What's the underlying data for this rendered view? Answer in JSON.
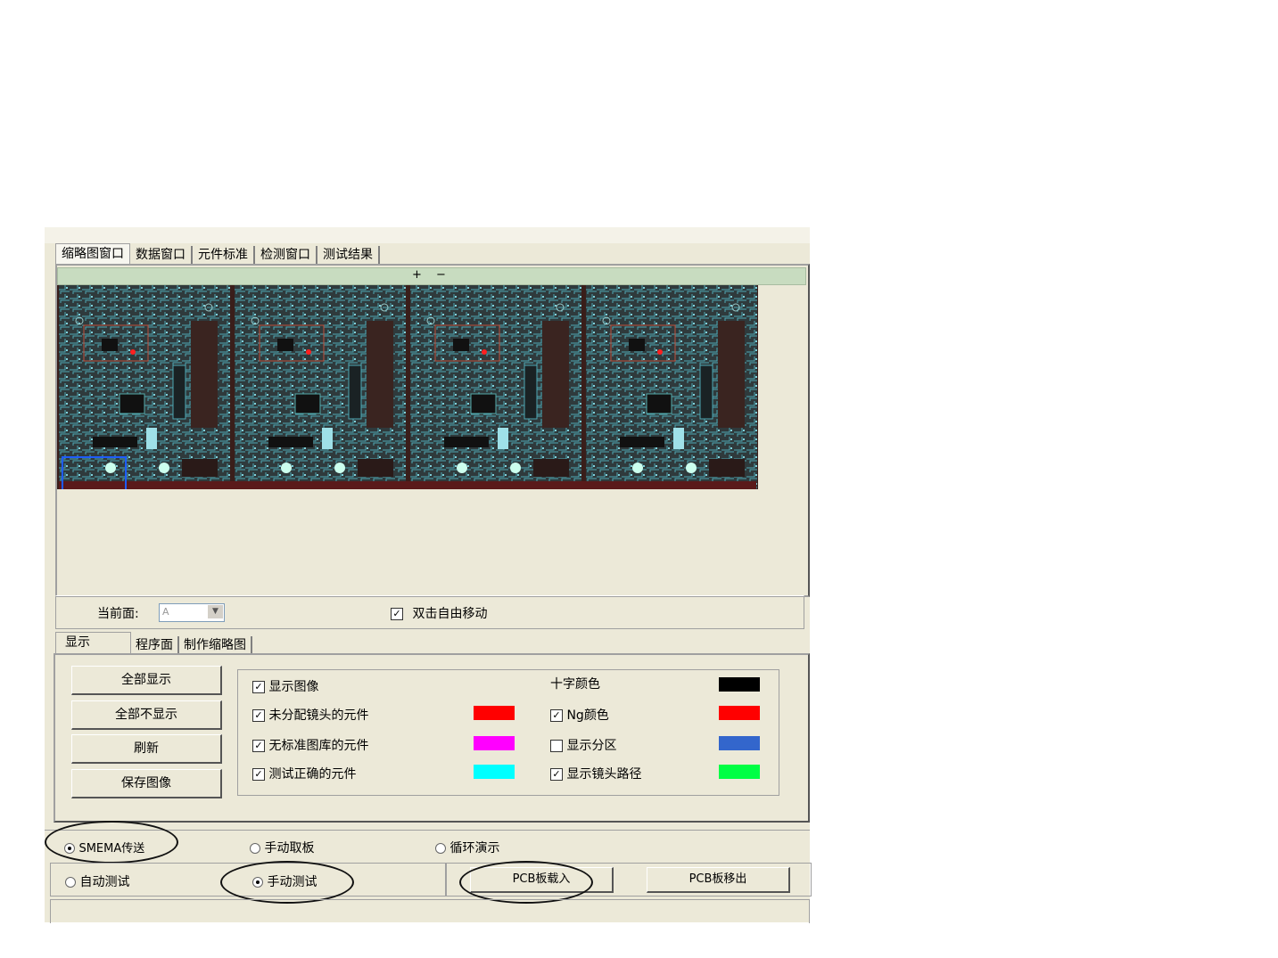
{
  "main_tabs": [
    "缩略图窗口",
    "数据窗口",
    "元件标准",
    "检测窗口",
    "测试结果"
  ],
  "zoom_bar": "+ −",
  "current_face": {
    "label": "当前面:",
    "value": "A"
  },
  "double_click_move": {
    "label": "双击自由移动",
    "checked": true
  },
  "display_tabs": [
    "显示",
    "程序面",
    "制作缩略图"
  ],
  "buttons": {
    "show_all": "全部显示",
    "hide_all": "全部不显示",
    "refresh": "刷新",
    "save_image": "保存图像"
  },
  "options": {
    "show_image": {
      "label": "显示图像",
      "checked": true
    },
    "unassigned_lens": {
      "label": "未分配镜头的元件",
      "checked": true,
      "color": "#ff0000"
    },
    "no_std_lib": {
      "label": "无标准图库的元件",
      "checked": true,
      "color": "#ff00ff"
    },
    "test_correct": {
      "label": "测试正确的元件",
      "checked": true,
      "color": "#00ffff"
    },
    "cross_color": {
      "label": "十字颜色",
      "color": "#000000"
    },
    "ng_color": {
      "label": "Ng颜色",
      "checked": true,
      "color": "#ff0000"
    },
    "show_zones": {
      "label": "显示分区",
      "checked": false,
      "color": "#3366cc"
    },
    "show_lens_path": {
      "label": "显示镜头路径",
      "checked": true,
      "color": "#00ff44"
    }
  },
  "modes": {
    "smema": {
      "label": "SMEMA传送",
      "selected": true
    },
    "manual_take": {
      "label": "手动取板",
      "selected": false
    },
    "loop_demo": {
      "label": "循环演示",
      "selected": false
    },
    "auto_test": {
      "label": "自动测试",
      "selected": false
    },
    "manual_test": {
      "label": "手动测试",
      "selected": true
    }
  },
  "pcb_buttons": {
    "load": "PCB板载入",
    "unload": "PCB板移出"
  }
}
